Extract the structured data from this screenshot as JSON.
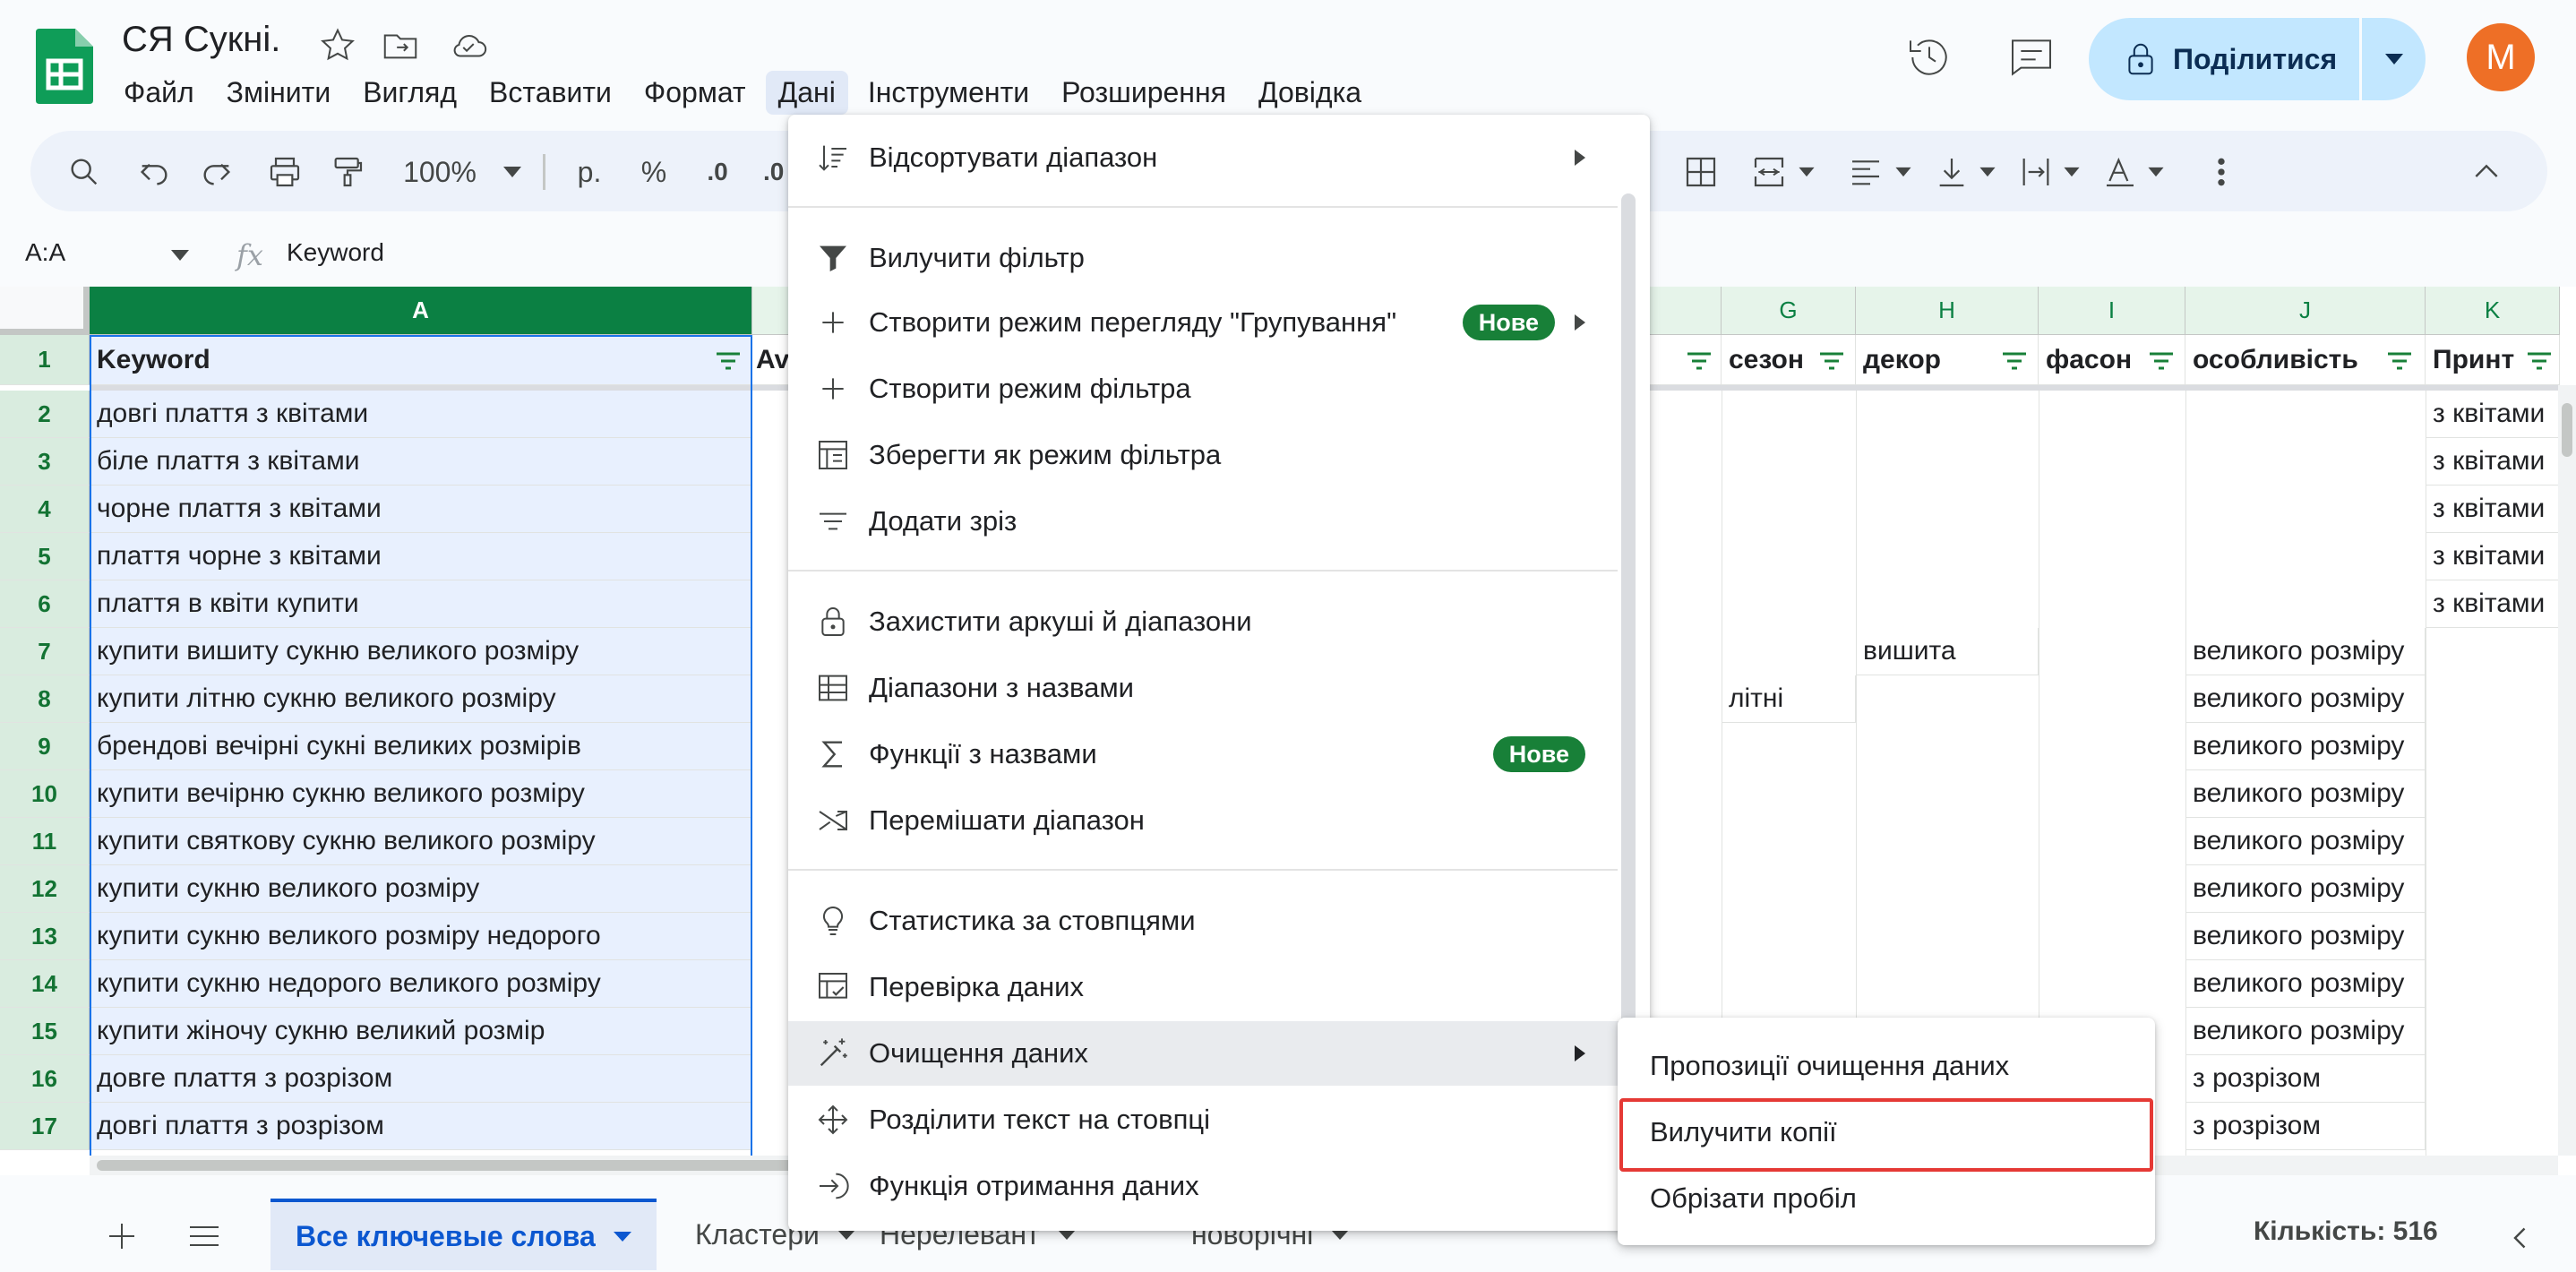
{
  "document": {
    "title": "СЯ Сукні."
  },
  "menubar": [
    "Файл",
    "Змінити",
    "Вигляд",
    "Вставити",
    "Формат",
    "Дані",
    "Інструменти",
    "Розширення",
    "Довідка"
  ],
  "share": {
    "label": "Поділитися"
  },
  "avatar": {
    "initial": "M",
    "color": "#ee6f26"
  },
  "toolbar": {
    "zoom": "100%",
    "currency": "р.",
    "percent": "%",
    "decimal": ".0"
  },
  "formula_bar": {
    "name_box": "A:A",
    "fx": "fx",
    "formula": "Keyword"
  },
  "columns": {
    "A": "A",
    "G": "G",
    "H": "H",
    "I": "I",
    "J": "J",
    "K": "K"
  },
  "header_row": {
    "A": "Keyword",
    "B": "Av",
    "G": "сезон",
    "H": "декор",
    "I": "фасон",
    "J": "особливість",
    "K": "Принт"
  },
  "rows": [
    {
      "n": "1"
    },
    {
      "n": "2",
      "A": "довгі плаття з квітами",
      "K": "з квітами"
    },
    {
      "n": "3",
      "A": "біле плаття з квітами",
      "K": "з квітами"
    },
    {
      "n": "4",
      "A": "чорне плаття з квітами",
      "K": "з квітами"
    },
    {
      "n": "5",
      "A": "плаття чорне з квітами",
      "K": "з квітами"
    },
    {
      "n": "6",
      "A": "плаття в квіти купити",
      "K": "з квітами"
    },
    {
      "n": "7",
      "A": "купити вишиту сукню великого розміру",
      "H": "вишита",
      "J": "великого розміру"
    },
    {
      "n": "8",
      "A": "купити літню сукню великого розміру",
      "G": "літні",
      "J": "великого розміру"
    },
    {
      "n": "9",
      "A": "брендові вечірні сукні великих розмірів",
      "J": "великого розміру"
    },
    {
      "n": "10",
      "A": "купити вечірню сукню великого розміру",
      "J": "великого розміру"
    },
    {
      "n": "11",
      "A": "купити святкову сукню великого розміру",
      "J": "великого розміру"
    },
    {
      "n": "12",
      "A": "купити сукню великого розміру",
      "J": "великого розміру"
    },
    {
      "n": "13",
      "A": "купити сукню великого розміру недорого",
      "J": "великого розміру"
    },
    {
      "n": "14",
      "A": "купити сукню недорого великого розміру",
      "J": "великого розміру"
    },
    {
      "n": "15",
      "A": "купити жіночу сукню великий розмір",
      "J": "великого розміру"
    },
    {
      "n": "16",
      "A": "довге плаття з розрізом",
      "J": "з розрізом"
    },
    {
      "n": "17",
      "A": "довгі плаття з розрізом",
      "J": "з розрізом"
    }
  ],
  "data_menu": {
    "items": [
      {
        "label": "Відсортувати діапазон",
        "icon": "sort-icon",
        "submenu": true
      },
      {
        "label": "Вилучити фільтр",
        "icon": "filter-icon"
      },
      {
        "label": "Створити режим перегляду \"Групування\"",
        "icon": "plus-icon",
        "badge": "Нове",
        "submenu": true
      },
      {
        "label": "Створити режим фільтра",
        "icon": "plus-icon"
      },
      {
        "label": "Зберегти як режим фільтра",
        "icon": "save-filter-icon"
      },
      {
        "label": "Додати зріз",
        "icon": "slicer-icon"
      },
      {
        "label": "Захистити аркуші й діапазони",
        "icon": "lock-icon"
      },
      {
        "label": "Діапазони з назвами",
        "icon": "named-range-icon"
      },
      {
        "label": "Функції з назвами",
        "icon": "sigma-icon",
        "badge": "Нове"
      },
      {
        "label": "Перемішати діапазон",
        "icon": "shuffle-icon"
      },
      {
        "label": "Статистика за стовпцями",
        "icon": "lightbulb-icon"
      },
      {
        "label": "Перевірка даних",
        "icon": "validation-icon"
      },
      {
        "label": "Очищення даних",
        "icon": "magic-wand-icon",
        "submenu": true,
        "highlighted": true
      },
      {
        "label": "Розділити текст на стовпці",
        "icon": "split-icon"
      },
      {
        "label": "Функція отримання даних",
        "icon": "extract-icon"
      }
    ]
  },
  "cleanup_submenu": {
    "items": [
      "Пропозиції очищення даних",
      "Вилучити копії",
      "Обрізати пробіл"
    ],
    "highlight_color": "#e53935"
  },
  "sheets": [
    {
      "label": "Все ключевые слова",
      "active": true
    },
    {
      "label": "Кластери"
    },
    {
      "label": "Нерелевант"
    },
    {
      "label": "новорічні"
    }
  ],
  "status": {
    "count": "Кількість: 516"
  },
  "colors": {
    "accent": "#0b57d0",
    "selected_column": "#0b8043",
    "share_bg": "#c2e7ff",
    "badge": "#188038"
  }
}
